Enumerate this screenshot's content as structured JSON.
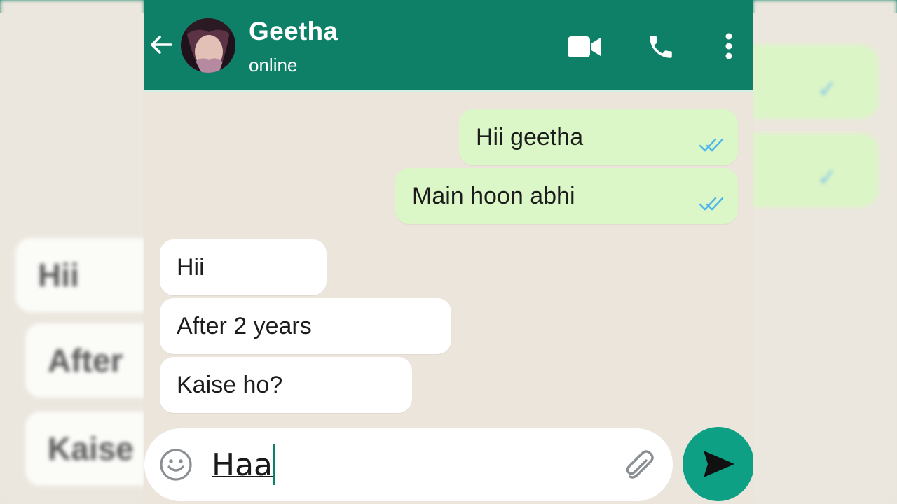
{
  "header": {
    "back_icon": "arrow-left-icon",
    "contact_name": "Geetha",
    "status": "online",
    "icons": [
      "video-call-icon",
      "voice-call-icon",
      "more-vert-icon"
    ]
  },
  "messages": [
    {
      "direction": "out",
      "text": "Hii geetha",
      "read": true
    },
    {
      "direction": "out",
      "text": "Main hoon abhi",
      "read": true
    },
    {
      "direction": "in",
      "text": "Hii"
    },
    {
      "direction": "in",
      "text": "After 2 years"
    },
    {
      "direction": "in",
      "text": "Kaise ho?"
    }
  ],
  "composer": {
    "value": "Haa",
    "emoji_icon": "smiley-icon",
    "attach_icon": "paperclip-icon",
    "send_icon": "send-icon"
  },
  "background_blur": {
    "left_texts": [
      "Hii",
      "After",
      "Kaise"
    ]
  },
  "colors": {
    "header": "#0e8068",
    "outgoing_bubble": "#dcf7c7",
    "incoming_bubble": "#ffffff",
    "send_button": "#0ea085",
    "read_ticks": "#4fb6ec"
  }
}
